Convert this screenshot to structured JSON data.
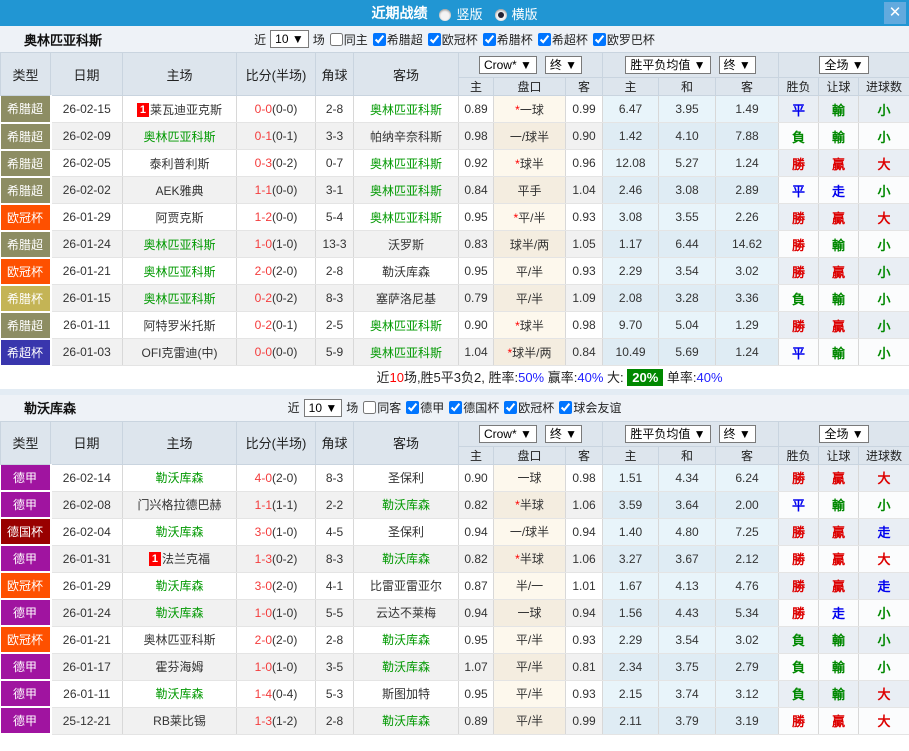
{
  "titlebar": {
    "title": "近期战绩",
    "close": "✕",
    "view_options": [
      {
        "label": "竖版",
        "selected": false
      },
      {
        "label": "横版",
        "selected": true
      }
    ]
  },
  "labels": {
    "header_cols": [
      "类型",
      "日期",
      "主场",
      "比分(半场)",
      "角球",
      "客场"
    ],
    "sub_cols": [
      "主",
      "盘口",
      "客",
      "主",
      "和",
      "客",
      "胜负",
      "让球",
      "进球数"
    ],
    "selects": [
      "Crow*",
      "终",
      "胜平负均值",
      "终",
      "全场"
    ]
  },
  "league_colors": {
    "希腊超": "#8d8d63",
    "欧冠杯": "#fe5000",
    "希腊杯": "#c4b455",
    "希超杯": "#3936ad",
    "德甲": "#a014a0",
    "德国杯": "#990000"
  },
  "result_colors": {
    "勝": "#dd0000",
    "贏": "#dd0000",
    "大": "#dd0000",
    "平": "#0000ee",
    "走": "#0000ee",
    "負": "#008800",
    "輸": "#008800",
    "小": "#008800"
  },
  "score_color": "#f43c3c",
  "focus_color": "#009900",
  "sections": [
    {
      "team": "奥林匹亚科斯",
      "filters": {
        "near": "近",
        "count": "10",
        "matches": "场",
        "same": {
          "label": "同主",
          "checked": false
        },
        "leagues": [
          {
            "label": "希腊超",
            "checked": true
          },
          {
            "label": "欧冠杯",
            "checked": true
          },
          {
            "label": "希腊杯",
            "checked": true
          },
          {
            "label": "希超杯",
            "checked": true
          },
          {
            "label": "欧罗巴杯",
            "checked": true
          }
        ]
      },
      "rows": [
        {
          "league": "希腊超",
          "date": "26-02-15",
          "home": "莱瓦迪亚克斯",
          "home_badge": "1",
          "home_focus": false,
          "ft": "0-0",
          "ht": "(0-0)",
          "corners": "2-8",
          "away": "奥林匹亚科斯",
          "away_focus": true,
          "oh": "0.89",
          "hcap": "*一球",
          "oa": "0.99",
          "aw": "6.47",
          "ad": "3.95",
          "al": "1.49",
          "res": "平",
          "hres": "輸",
          "gres": "小"
        },
        {
          "league": "希腊超",
          "date": "26-02-09",
          "home": "奥林匹亚科斯",
          "home_focus": true,
          "ft": "0-1",
          "ht": "(0-1)",
          "corners": "3-3",
          "away": "帕纳辛奈科斯",
          "away_focus": false,
          "oh": "0.98",
          "hcap": "一/球半",
          "oa": "0.90",
          "aw": "1.42",
          "ad": "4.10",
          "al": "7.88",
          "res": "負",
          "hres": "輸",
          "gres": "小"
        },
        {
          "league": "希腊超",
          "date": "26-02-05",
          "home": "泰利普利斯",
          "home_focus": false,
          "ft": "0-3",
          "ht": "(0-2)",
          "corners": "0-7",
          "away": "奥林匹亚科斯",
          "away_focus": true,
          "oh": "0.92",
          "hcap": "*球半",
          "oa": "0.96",
          "aw": "12.08",
          "ad": "5.27",
          "al": "1.24",
          "res": "勝",
          "hres": "贏",
          "gres": "大"
        },
        {
          "league": "希腊超",
          "date": "26-02-02",
          "home": "AEK雅典",
          "home_focus": false,
          "ft": "1-1",
          "ht": "(0-0)",
          "corners": "3-1",
          "away": "奥林匹亚科斯",
          "away_focus": true,
          "oh": "0.84",
          "hcap": "平手",
          "oa": "1.04",
          "aw": "2.46",
          "ad": "3.08",
          "al": "2.89",
          "res": "平",
          "hres": "走",
          "gres": "小"
        },
        {
          "league": "欧冠杯",
          "date": "26-01-29",
          "home": "阿贾克斯",
          "home_focus": false,
          "ft": "1-2",
          "ht": "(0-0)",
          "corners": "5-4",
          "away": "奥林匹亚科斯",
          "away_focus": true,
          "oh": "0.95",
          "hcap": "*平/半",
          "oa": "0.93",
          "aw": "3.08",
          "ad": "3.55",
          "al": "2.26",
          "res": "勝",
          "hres": "贏",
          "gres": "大"
        },
        {
          "league": "希腊超",
          "date": "26-01-24",
          "home": "奥林匹亚科斯",
          "home_focus": true,
          "ft": "1-0",
          "ht": "(1-0)",
          "corners": "13-3",
          "away": "沃罗斯",
          "away_focus": false,
          "oh": "0.83",
          "hcap": "球半/两",
          "oa": "1.05",
          "aw": "1.17",
          "ad": "6.44",
          "al": "14.62",
          "res": "勝",
          "hres": "輸",
          "gres": "小"
        },
        {
          "league": "欧冠杯",
          "date": "26-01-21",
          "home": "奥林匹亚科斯",
          "home_focus": true,
          "ft": "2-0",
          "ht": "(2-0)",
          "corners": "2-8",
          "away": "勒沃库森",
          "away_focus": false,
          "oh": "0.95",
          "hcap": "平/半",
          "oa": "0.93",
          "aw": "2.29",
          "ad": "3.54",
          "al": "3.02",
          "res": "勝",
          "hres": "贏",
          "gres": "小"
        },
        {
          "league": "希腊杯",
          "date": "26-01-15",
          "home": "奥林匹亚科斯",
          "home_focus": true,
          "ft": "0-2",
          "ht": "(0-2)",
          "corners": "8-3",
          "away": "塞萨洛尼基",
          "away_focus": false,
          "oh": "0.79",
          "hcap": "平/半",
          "oa": "1.09",
          "aw": "2.08",
          "ad": "3.28",
          "al": "3.36",
          "res": "負",
          "hres": "輸",
          "gres": "小"
        },
        {
          "league": "希腊超",
          "date": "26-01-11",
          "home": "阿特罗米托斯",
          "home_focus": false,
          "ft": "0-2",
          "ht": "(0-1)",
          "corners": "2-5",
          "away": "奥林匹亚科斯",
          "away_focus": true,
          "oh": "0.90",
          "hcap": "*球半",
          "oa": "0.98",
          "aw": "9.70",
          "ad": "5.04",
          "al": "1.29",
          "res": "勝",
          "hres": "贏",
          "gres": "小"
        },
        {
          "league": "希超杯",
          "date": "26-01-03",
          "home": "OFI克雷迪(中)",
          "home_focus": false,
          "ft": "0-0",
          "ht": "(0-0)",
          "corners": "5-9",
          "away": "奥林匹亚科斯",
          "away_focus": true,
          "oh": "1.04",
          "hcap": "*球半/两",
          "oa": "0.84",
          "aw": "10.49",
          "ad": "5.69",
          "al": "1.24",
          "res": "平",
          "hres": "輸",
          "gres": "小"
        }
      ],
      "summary": [
        {
          "t": "近",
          "c": "#222222"
        },
        {
          "t": "10",
          "c": "#ff0000"
        },
        {
          "t": "场,胜5平3负2, ",
          "c": "#222222"
        },
        {
          "t": "胜率:",
          "c": "#222222"
        },
        {
          "t": "50%",
          "c": "#2222ff"
        },
        {
          "t": " 赢率:",
          "c": "#222222"
        },
        {
          "t": "40%",
          "c": "#2222ff"
        },
        {
          "t": " 大: ",
          "c": "#222222"
        },
        {
          "t": "20%",
          "c": "#ffffff",
          "bg": "#008800"
        },
        {
          "t": " 单率:",
          "c": "#222222"
        },
        {
          "t": "40%",
          "c": "#2222ff"
        }
      ]
    },
    {
      "team": "勒沃库森",
      "filters": {
        "near": "近",
        "count": "10",
        "matches": "场",
        "same": {
          "label": "同客",
          "checked": false
        },
        "leagues": [
          {
            "label": "德甲",
            "checked": true
          },
          {
            "label": "德国杯",
            "checked": true
          },
          {
            "label": "欧冠杯",
            "checked": true
          },
          {
            "label": "球会友谊",
            "checked": true
          }
        ]
      },
      "rows": [
        {
          "league": "德甲",
          "date": "26-02-14",
          "home": "勒沃库森",
          "home_focus": true,
          "ft": "4-0",
          "ht": "(2-0)",
          "corners": "8-3",
          "away": "圣保利",
          "away_focus": false,
          "oh": "0.90",
          "hcap": "一球",
          "oa": "0.98",
          "aw": "1.51",
          "ad": "4.34",
          "al": "6.24",
          "res": "勝",
          "hres": "贏",
          "gres": "大"
        },
        {
          "league": "德甲",
          "date": "26-02-08",
          "home": "门兴格拉德巴赫",
          "home_focus": false,
          "ft": "1-1",
          "ht": "(1-1)",
          "corners": "2-2",
          "away": "勒沃库森",
          "away_focus": true,
          "oh": "0.82",
          "hcap": "*半球",
          "oa": "1.06",
          "aw": "3.59",
          "ad": "3.64",
          "al": "2.00",
          "res": "平",
          "hres": "輸",
          "gres": "小"
        },
        {
          "league": "德国杯",
          "date": "26-02-04",
          "home": "勒沃库森",
          "home_focus": true,
          "ft": "3-0",
          "ht": "(1-0)",
          "corners": "4-5",
          "away": "圣保利",
          "away_focus": false,
          "oh": "0.94",
          "hcap": "一/球半",
          "oa": "0.94",
          "aw": "1.40",
          "ad": "4.80",
          "al": "7.25",
          "res": "勝",
          "hres": "贏",
          "gres": "走"
        },
        {
          "league": "德甲",
          "date": "26-01-31",
          "home": "法兰克福",
          "home_badge": "1",
          "home_focus": false,
          "ft": "1-3",
          "ht": "(0-2)",
          "corners": "8-3",
          "away": "勒沃库森",
          "away_focus": true,
          "oh": "0.82",
          "hcap": "*半球",
          "oa": "1.06",
          "aw": "3.27",
          "ad": "3.67",
          "al": "2.12",
          "res": "勝",
          "hres": "贏",
          "gres": "大"
        },
        {
          "league": "欧冠杯",
          "date": "26-01-29",
          "home": "勒沃库森",
          "home_focus": true,
          "ft": "3-0",
          "ht": "(2-0)",
          "corners": "4-1",
          "away": "比雷亚雷亚尔",
          "away_focus": false,
          "oh": "0.87",
          "hcap": "半/一",
          "oa": "1.01",
          "aw": "1.67",
          "ad": "4.13",
          "al": "4.76",
          "res": "勝",
          "hres": "贏",
          "gres": "走"
        },
        {
          "league": "德甲",
          "date": "26-01-24",
          "home": "勒沃库森",
          "home_focus": true,
          "ft": "1-0",
          "ht": "(1-0)",
          "corners": "5-5",
          "away": "云达不莱梅",
          "away_focus": false,
          "oh": "0.94",
          "hcap": "一球",
          "oa": "0.94",
          "aw": "1.56",
          "ad": "4.43",
          "al": "5.34",
          "res": "勝",
          "hres": "走",
          "gres": "小"
        },
        {
          "league": "欧冠杯",
          "date": "26-01-21",
          "home": "奥林匹亚科斯",
          "home_focus": false,
          "ft": "2-0",
          "ht": "(2-0)",
          "corners": "2-8",
          "away": "勒沃库森",
          "away_focus": true,
          "oh": "0.95",
          "hcap": "平/半",
          "oa": "0.93",
          "aw": "2.29",
          "ad": "3.54",
          "al": "3.02",
          "res": "負",
          "hres": "輸",
          "gres": "小"
        },
        {
          "league": "德甲",
          "date": "26-01-17",
          "home": "霍芬海姆",
          "home_focus": false,
          "ft": "1-0",
          "ht": "(1-0)",
          "corners": "3-5",
          "away": "勒沃库森",
          "away_focus": true,
          "oh": "1.07",
          "hcap": "平/半",
          "oa": "0.81",
          "aw": "2.34",
          "ad": "3.75",
          "al": "2.79",
          "res": "負",
          "hres": "輸",
          "gres": "小"
        },
        {
          "league": "德甲",
          "date": "26-01-11",
          "home": "勒沃库森",
          "home_focus": true,
          "ft": "1-4",
          "ht": "(0-4)",
          "corners": "5-3",
          "away": "斯图加特",
          "away_focus": false,
          "oh": "0.95",
          "hcap": "平/半",
          "oa": "0.93",
          "aw": "2.15",
          "ad": "3.74",
          "al": "3.12",
          "res": "負",
          "hres": "輸",
          "gres": "大"
        },
        {
          "league": "德甲",
          "date": "25-12-21",
          "home": "RB莱比锡",
          "home_focus": false,
          "ft": "1-3",
          "ht": "(1-2)",
          "corners": "2-8",
          "away": "勒沃库森",
          "away_focus": true,
          "oh": "0.89",
          "hcap": "平/半",
          "oa": "0.99",
          "aw": "2.11",
          "ad": "3.79",
          "al": "3.19",
          "res": "勝",
          "hres": "贏",
          "gres": "大"
        }
      ]
    }
  ]
}
